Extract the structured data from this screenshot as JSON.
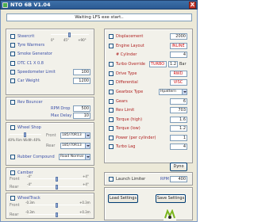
{
  "window": {
    "title": "NTO 6B V1.04",
    "close_glyph": "X"
  },
  "status": "Waiting LFS exe start..",
  "left": {
    "checkboxes_top": [
      {
        "label": "Steercrit"
      },
      {
        "label": "Tyre Warmers"
      },
      {
        "label": "Smoke Generator"
      },
      {
        "label": "DTC C1 X 0.8"
      },
      {
        "label": "Speedometer Limit",
        "value": "100"
      },
      {
        "label": "Car Weight",
        "value": "1200"
      }
    ],
    "steer_slider": {
      "low": "0°",
      "mid": "45°",
      "high": "+90°"
    },
    "rev_bouncer": {
      "label": "Rev Bouncer",
      "rpm_drop_label": "RPM Drop",
      "rpm_drop_value": "500",
      "max_delay_label": "Max Delay",
      "max_delay_value": "10"
    },
    "wheel_shop": {
      "label": "Wheel Shop",
      "pct_label": "40% Rim Width 40%",
      "front_label": "Front",
      "front_value": "185/70R13",
      "rear_label": "Rear",
      "rear_value": "185/70R13",
      "rubber_label": "Rubber Compound",
      "rubber_value": "Road Normal"
    },
    "camber": {
      "label": "Camber",
      "front_label": "Front",
      "front_low": "-4°",
      "front_high": "+4°",
      "rear_label": "Rear",
      "rear_low": "-4°",
      "rear_high": "+4°"
    },
    "wheeltrack": {
      "label": "WheelTrack",
      "front_label": "Front",
      "front_low": "-0.3m",
      "front_high": "+0.3m",
      "rear_label": "Rear",
      "rear_low": "-0.3m",
      "rear_high": "+0.3m"
    }
  },
  "right": {
    "rows": [
      {
        "label": "Displacement",
        "value": "2000"
      },
      {
        "label": "Engine Layout",
        "value": "INLINE"
      },
      {
        "label": "# Cylinder",
        "value": "4"
      },
      {
        "label": "Turbo Override",
        "value": "TURBO",
        "extra": "1.2",
        "unit": "Bar"
      },
      {
        "label": "Drive Type",
        "value": "RWD"
      },
      {
        "label": "Differential",
        "value": "VISC"
      },
      {
        "label": "Gearbox Type",
        "value": "Hpattern"
      },
      {
        "label": "Gears",
        "value": "6"
      },
      {
        "label": "Rev Limit",
        "value": "703"
      },
      {
        "label": "Torque (high)",
        "value": "1.6"
      },
      {
        "label": "Torque (low)",
        "value": "1.2"
      },
      {
        "label": "Power (per cylinder)",
        "value": "1"
      },
      {
        "label": "Turbo Lag",
        "value": "4"
      }
    ],
    "dyno_label": "Dyno",
    "launch_limiter": {
      "label": "Launch Limiter",
      "rpm_label": "RPM",
      "rpm_value": "400"
    },
    "load_label": "Load Settings",
    "save_label": "Save Settings"
  },
  "colors": {
    "accent": "#3a4fa8",
    "warn": "#b02222",
    "panel": "#ece9d8"
  }
}
